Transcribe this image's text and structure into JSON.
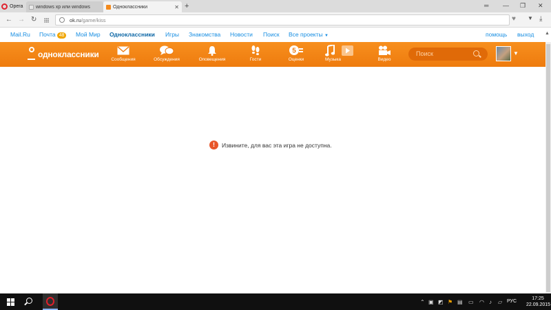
{
  "browser": {
    "name": "Opera",
    "tabs": [
      {
        "title": "windows xp или windows",
        "favicon_color": "#e8e8e8",
        "active": false
      },
      {
        "title": "Одноклассники",
        "favicon_color": "#f38a1d",
        "active": true
      }
    ],
    "new_tab_glyph": "+",
    "window_controls": [
      "═",
      "—",
      "❐",
      "✕"
    ]
  },
  "address": {
    "host": "ok.ru",
    "path": "/game/kiss"
  },
  "mailnav": {
    "items": [
      {
        "label": "Mail.Ru"
      },
      {
        "label": "Почта",
        "badge": "48"
      },
      {
        "label": "Мой Мир"
      },
      {
        "label": "Одноклассники",
        "active": true
      },
      {
        "label": "Игры"
      },
      {
        "label": "Знакомства"
      },
      {
        "label": "Новости"
      },
      {
        "label": "Поиск"
      },
      {
        "label": "Все проекты"
      }
    ],
    "help": "помощь",
    "logout": "выход"
  },
  "okbar": {
    "logo": "одноклассники",
    "items": [
      {
        "label": "Сообщения",
        "icon": "envelope-icon"
      },
      {
        "label": "Обсуждения",
        "icon": "chat-bubbles-icon"
      },
      {
        "label": "Оповещения",
        "icon": "bell-icon"
      },
      {
        "label": "Гости",
        "icon": "footprints-icon"
      },
      {
        "label": "Оценки",
        "icon": "rating-icon"
      },
      {
        "label": "Музыка",
        "icon": "music-note-icon"
      },
      {
        "label": "Видео",
        "icon": "video-camera-icon"
      }
    ],
    "search_placeholder": "Поиск"
  },
  "main": {
    "message_icon": "!",
    "message": "Извините, для вас эта игра не доступна."
  },
  "taskbar": {
    "language": "РУС",
    "time": "17:25",
    "date": "22.09.2015"
  },
  "colors": {
    "ok_orange": "#f78f1e",
    "link_blue": "#168de2",
    "error_red": "#e8562a"
  }
}
